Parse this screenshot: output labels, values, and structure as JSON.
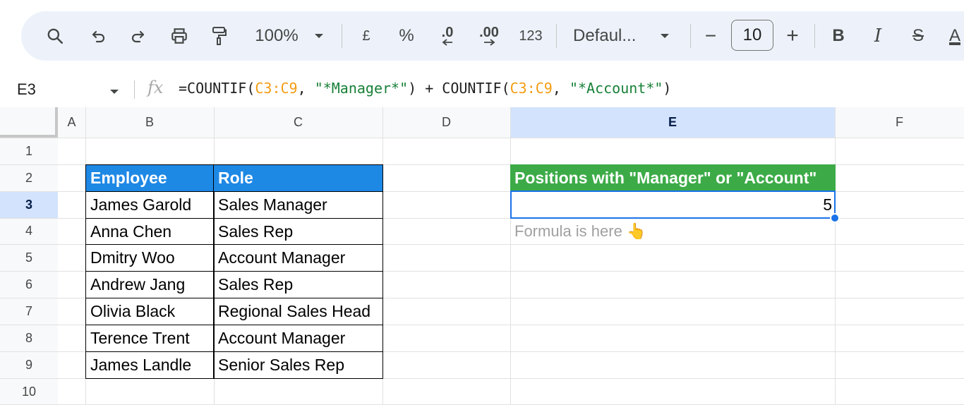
{
  "toolbar": {
    "zoom": "100%",
    "currency": "£",
    "percent": "%",
    "dec_decrease": ".0",
    "dec_increase": ".00",
    "more_formats": "123",
    "font": "Defaul...",
    "minus": "−",
    "font_size": "10",
    "plus": "+",
    "bold": "B",
    "italic": "I",
    "strike": "S",
    "text_color": "A"
  },
  "formula_bar": {
    "cell_ref": "E3",
    "fx": "fx",
    "formula_parts": [
      "=COUNTIF(",
      "C3:C9",
      ", ",
      "\"*Manager*\"",
      ") + COUNTIF(",
      "C3:C9",
      ", ",
      "\"*Account*\"",
      ")"
    ]
  },
  "columns": [
    "A",
    "B",
    "C",
    "D",
    "E",
    "F"
  ],
  "rows": [
    "1",
    "2",
    "3",
    "4",
    "5",
    "6",
    "7",
    "8",
    "9",
    "10"
  ],
  "table": {
    "headers": [
      "Employee",
      "Role"
    ],
    "rows": [
      [
        "James Garold",
        "Sales Manager"
      ],
      [
        "Anna Chen",
        "Sales Rep"
      ],
      [
        "Dmitry Woo",
        "Account Manager"
      ],
      [
        "Andrew Jang",
        "Sales Rep"
      ],
      [
        "Olivia Black",
        "Regional Sales Head"
      ],
      [
        "Terence Trent",
        "Account Manager"
      ],
      [
        "James Landle",
        "Senior Sales Rep"
      ]
    ]
  },
  "result": {
    "header": "Positions with \"Manager\" or \"Account\"",
    "value": "5",
    "note": "Formula is here 👆"
  },
  "colors": {
    "header_blue": "#1e88e5",
    "header_green": "#3cab47",
    "selection": "#1a73e8",
    "range_orange": "#f39c12",
    "string_green": "#188038"
  }
}
